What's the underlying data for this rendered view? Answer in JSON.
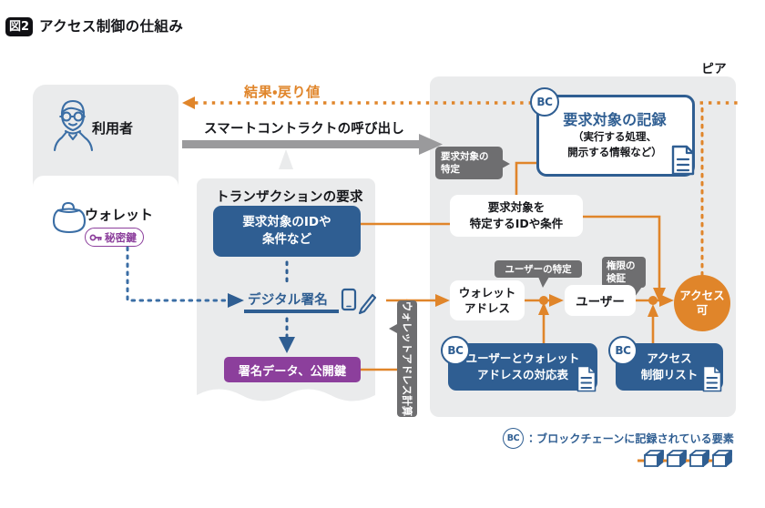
{
  "figure": {
    "badge": "図2",
    "title": "アクセス制御の仕組み"
  },
  "labels": {
    "peer": "ピア",
    "result_return": "結果・戻り値",
    "smart_contract_call": "スマートコントラクトの呼び出し"
  },
  "user_panel": {
    "user_label": "利用者",
    "user_icon": "person-with-glasses-icon",
    "wallet_label": "ウォレット",
    "wallet_icon": "purse-icon",
    "secret_key_badge": "秘密鍵",
    "secret_key_icon": "key-icon"
  },
  "transaction_panel": {
    "title": "トランザクションの要求",
    "request_box": "要求対象のIDや条件など",
    "request_box_line1": "要求対象のIDや",
    "request_box_line2": "条件など",
    "digital_signature": "デジタル署名",
    "phone_icon": "smartphone-icon",
    "pen_icon": "pen-icon",
    "signature_data": "署名データ、公開鍵"
  },
  "wallet_calc_label": "ウォレットアドレス計算",
  "peer_panel": {
    "bc_record": {
      "badge": "BC",
      "title": "要求対象の記録",
      "sub_line1": "（実行する処理、",
      "sub_line2": "開示する情報など）",
      "doc_icon": "document-icon"
    },
    "callout_target_identify_line1": "要求対象の",
    "callout_target_identify_line2": "特定",
    "id_cond_box_line1": "要求対象を",
    "id_cond_box_line2": "特定するIDや条件",
    "wallet_address_line1": "ウォレット",
    "wallet_address_line2": "アドレス",
    "user_node": "ユーザー",
    "access_allowed_line1": "アクセス",
    "access_allowed_line2": "可",
    "callout_user_identify": "ユーザーの特定",
    "callout_auth_line1": "権限の",
    "callout_auth_line2": "検証",
    "bc_map_box": {
      "badge": "BC",
      "line1": "ユーザーとウォレット",
      "line2": "アドレスの対応表",
      "doc_icon": "document-icon"
    },
    "bc_acl_box": {
      "badge": "BC",
      "line1": "アクセス",
      "line2": "制御リスト",
      "doc_icon": "document-icon"
    }
  },
  "legend": {
    "badge": "BC",
    "text": "：ブロックチェーンに記録されている要素",
    "chain_icon": "blockchain-cubes-icon"
  },
  "colors": {
    "blue": "#2f5e92",
    "orange": "#e0852a",
    "purple": "#8c3f9c",
    "gray_panel": "#eaebec",
    "gray_callout": "#6e6e70",
    "gray_arrow": "#9a9a9c"
  }
}
